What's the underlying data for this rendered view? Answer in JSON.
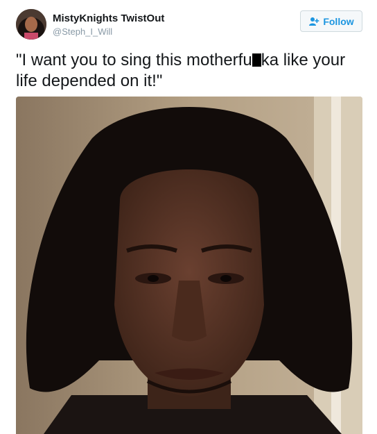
{
  "user": {
    "display_name": "MistyKnights TwistOut",
    "handle": "@Steph_I_Will"
  },
  "follow_button": {
    "label": "Follow",
    "icon": "add-user-icon",
    "color": "#1b95e0"
  },
  "tweet": {
    "text_part1": "\"I want you to sing this motherfu",
    "text_part2": "ka like your life depended on it!\""
  },
  "media": {
    "icon": "photo"
  }
}
